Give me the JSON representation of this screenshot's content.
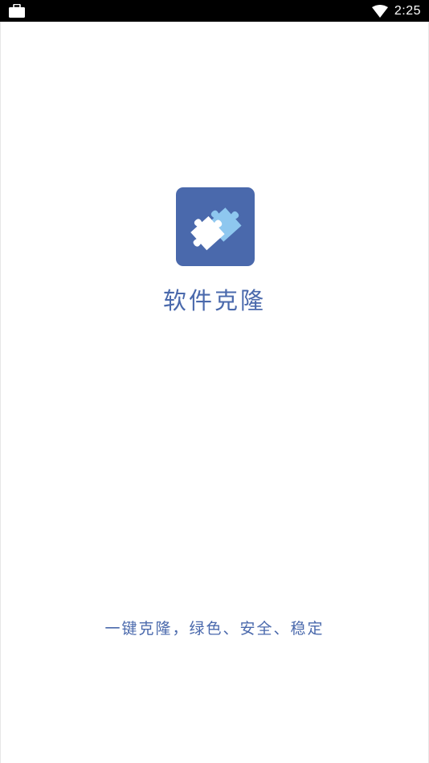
{
  "status_bar": {
    "time": "2:25",
    "left_icon": "briefcase-icon",
    "right_icon": "wifi-icon"
  },
  "splash": {
    "app_name": "软件克隆",
    "tagline": "一键克隆，绿色、安全、稳定",
    "logo_icon": "puzzle-icon"
  },
  "colors": {
    "brand": "#4a69ac",
    "accent": "#8ec7ef",
    "status_bar_bg": "#000000"
  }
}
